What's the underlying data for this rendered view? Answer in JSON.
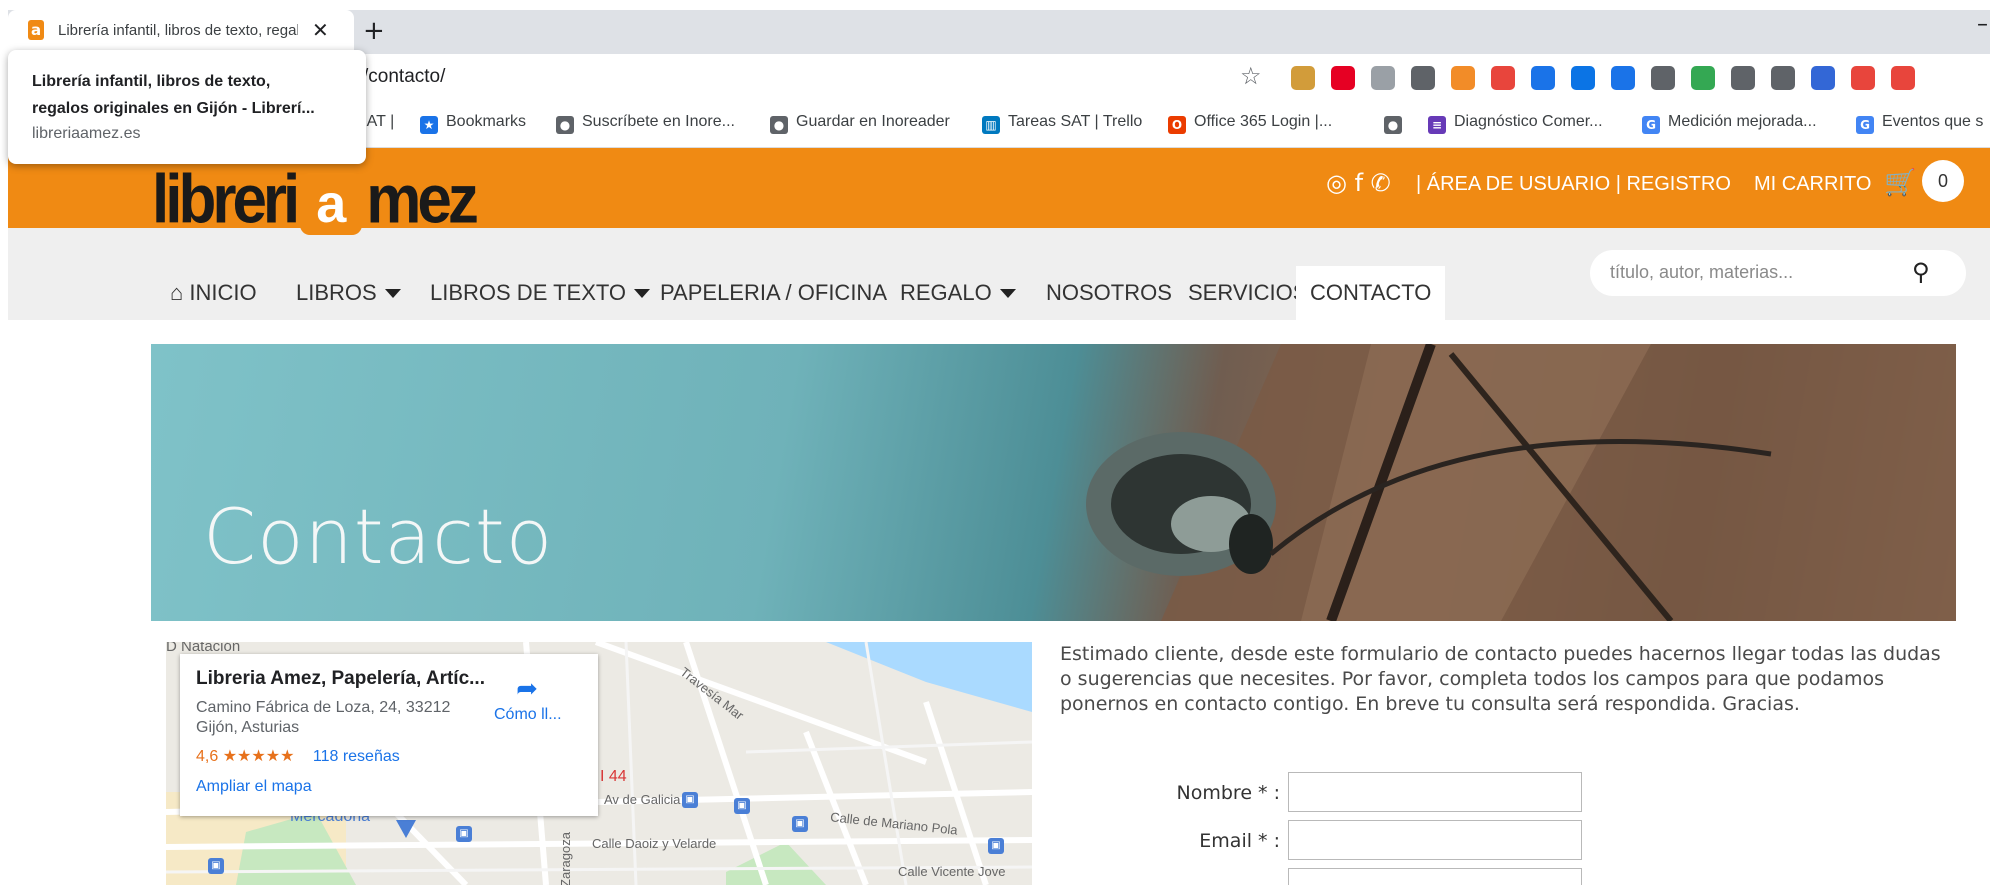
{
  "browser": {
    "tab_title": "Librería infantil, libros de texto, regalos originales en Gijón - Librería Amez",
    "new_tab": "+",
    "close": "✕",
    "minimize": "–",
    "url_visible": "/contacto/",
    "tooltip": {
      "title_line1": "Librería infantil, libros de texto,",
      "title_line2": "regalos originales en Gijón - Librerí...",
      "host": "libreriaamez.es"
    },
    "bookmarks": [
      {
        "label": "SAT |",
        "icon": "sat-icon",
        "color": "#9aa0a6"
      },
      {
        "label": "Bookmarks",
        "icon": "star-icon",
        "color": "#1a73e8"
      },
      {
        "label": "Suscríbete en Inore...",
        "icon": "globe-icon",
        "color": "#5f6368"
      },
      {
        "label": "Guardar en Inoreader",
        "icon": "globe-icon",
        "color": "#5f6368"
      },
      {
        "label": "Tareas SAT | Trello",
        "icon": "trello-icon",
        "color": "#0079bf"
      },
      {
        "label": "Office 365 Login |...",
        "icon": "office-icon",
        "color": "#eb3c00"
      },
      {
        "label": "",
        "icon": "globe-icon",
        "color": "#5f6368"
      },
      {
        "label": "Diagnóstico Comer...",
        "icon": "list-icon",
        "color": "#673ab7"
      },
      {
        "label": "Medición mejorada...",
        "icon": "google-icon",
        "color": "#4285f4"
      },
      {
        "label": "Eventos que s",
        "icon": "google-icon",
        "color": "#4285f4"
      }
    ],
    "extensions": [
      "#d29c3a",
      "#e60023",
      "#9aa0a6",
      "#5f6368",
      "#f28c28",
      "#e8453c",
      "#1a73e8",
      "#0b74e5",
      "#1a73e8",
      "#5f6368",
      "#34a853",
      "#5f6368",
      "#5f6368",
      "#3367d6",
      "#e8453c",
      "#e8453c"
    ]
  },
  "site": {
    "brand_color": "#f08a13",
    "logo": {
      "part1": "libreri",
      "a": "a",
      "part2": "mez"
    },
    "social_icons": "◎ f ✆",
    "user_links": "| ÁREA DE USUARIO | REGISTRO",
    "cart_label": "MI CARRITO",
    "cart_count": "0",
    "nav": [
      {
        "label": "INICIO",
        "icon": "home-icon",
        "dropdown": false
      },
      {
        "label": "LIBROS",
        "dropdown": true
      },
      {
        "label": "LIBROS DE TEXTO",
        "dropdown": true
      },
      {
        "label": "PAPELERIA / OFICINA",
        "dropdown": false
      },
      {
        "label": "REGALO",
        "dropdown": true
      },
      {
        "label": "NOSOTROS",
        "dropdown": false
      },
      {
        "label": "SERVICIOS",
        "dropdown": false
      },
      {
        "label": "CONTACTO",
        "dropdown": false,
        "active": true
      }
    ],
    "search_placeholder": "título, autor, materias...",
    "hero_title": "Contacto"
  },
  "map": {
    "place_name": "Libreria Amez, Papelería, Artíc...",
    "address_line1": "Camino Fábrica de Loza, 24, 33212",
    "address_line2": "Gijón, Asturias",
    "rating": "4,6",
    "stars": "★★★★★",
    "reviews": "118 reseñas",
    "enlarge": "Ampliar el mapa",
    "directions": "Cómo ll...",
    "streets": [
      "Travesía Mar",
      "Av de Galicia",
      "Calle Daoiz y Velarde",
      "Calle de Mariano Pola",
      "Calle Vicente Jove",
      "Zaragoza",
      "Mercadona",
      "D Natación",
      "I 44"
    ]
  },
  "contact_form": {
    "intro": "Estimado cliente, desde este formulario de contacto puedes hacernos llegar todas las dudas o sugerencias que necesites. Por favor, completa todos los campos para que podamos ponernos en contacto contigo. En breve tu consulta será respondida. Gracias.",
    "name_label": "Nombre * :",
    "email_label": "Email * :",
    "name_value": "",
    "email_value": ""
  }
}
